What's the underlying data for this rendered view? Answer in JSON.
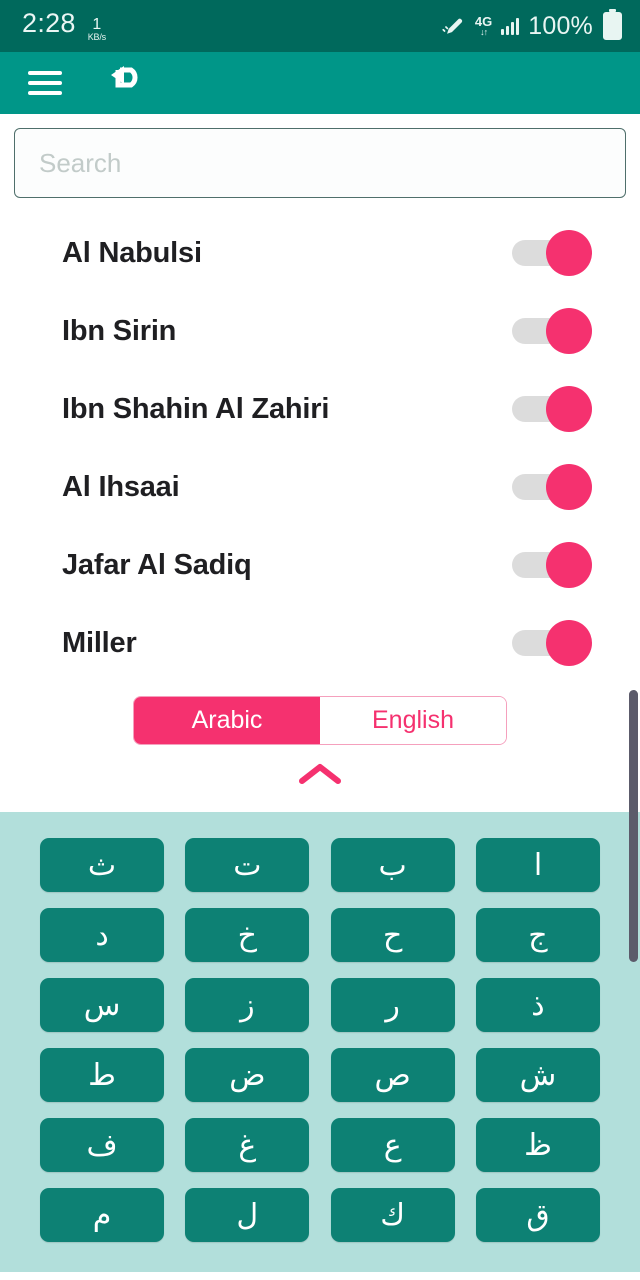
{
  "status_bar": {
    "clock": "2:28",
    "net_speed_value": "1",
    "net_speed_unit": "KB/s",
    "pencil_icon": "pencil-icon",
    "network_type": "4G",
    "network_arrows": "↓↑",
    "signal_icon": "signal-bars-icon",
    "battery_percent": "100%",
    "battery_icon": "battery-full-icon",
    "background_color": "#00695c"
  },
  "app_bar": {
    "menu_icon": "hamburger-menu-icon",
    "undo_icon": "undo-arrow-icon",
    "background_color": "#009688"
  },
  "search": {
    "value": "",
    "placeholder": "Search"
  },
  "list": {
    "items": [
      {
        "label": "Al Nabulsi",
        "enabled": true
      },
      {
        "label": "Ibn Sirin",
        "enabled": true
      },
      {
        "label": "Ibn Shahin Al Zahiri",
        "enabled": true
      },
      {
        "label": "Al Ihsaai",
        "enabled": true
      },
      {
        "label": "Jafar Al Sadiq",
        "enabled": true
      },
      {
        "label": "Miller",
        "enabled": true
      }
    ],
    "toggle_on_color": "#f5316f",
    "toggle_track_color": "#dcdcdc"
  },
  "language_toggle": {
    "options": [
      {
        "label": "Arabic",
        "selected": true
      },
      {
        "label": "English",
        "selected": false
      }
    ],
    "accent_color": "#f5316f"
  },
  "collapse_control": {
    "icon": "chevron-up-icon",
    "color": "#f5316f"
  },
  "keyboard": {
    "background_color": "#b2dfdb",
    "key_color": "#0d8174",
    "rows": [
      [
        "ا",
        "ب",
        "ت",
        "ث"
      ],
      [
        "ج",
        "ح",
        "خ",
        "د"
      ],
      [
        "ذ",
        "ر",
        "ز",
        "س"
      ],
      [
        "ش",
        "ص",
        "ض",
        "ط"
      ],
      [
        "ظ",
        "ع",
        "غ",
        "ف"
      ],
      [
        "ق",
        "ك",
        "ل",
        "م"
      ]
    ]
  },
  "scrollbar": {
    "visible": true
  }
}
